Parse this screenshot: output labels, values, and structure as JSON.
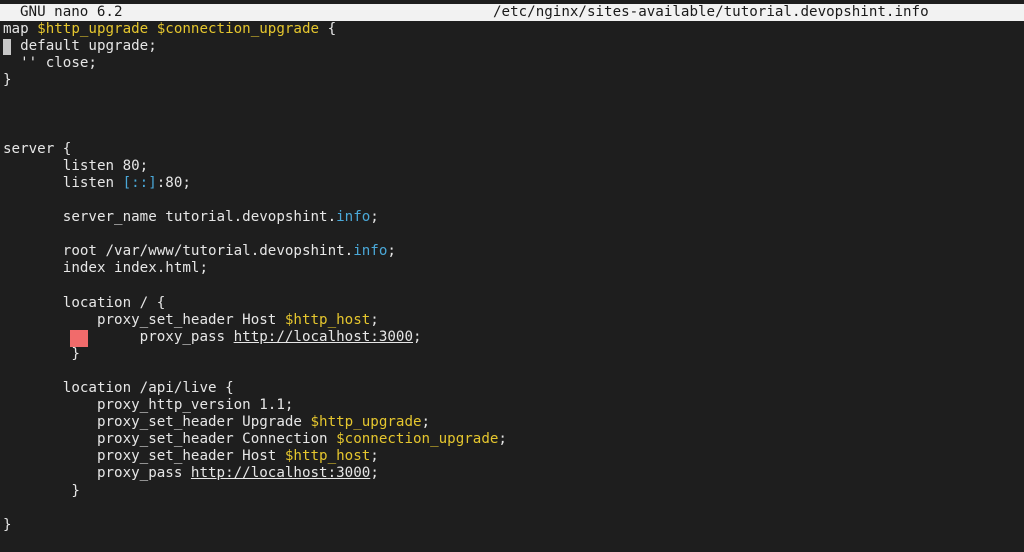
{
  "titlebar": {
    "app": "GNU nano 6.2",
    "file": "/etc/nginx/sites-available/tutorial.devopshint.info"
  },
  "colors": {
    "background": "#1e1e1e",
    "text": "#e6e6e6",
    "variable": "#e5c62e",
    "keyword": "#4aa8d8",
    "titlebar": "#f2f2f2",
    "marker": "#f16b6b"
  },
  "editor": {
    "lines": [
      [
        {
          "t": "map "
        },
        {
          "t": "$http_upgrade $connection_upgrade",
          "c": "yellow"
        },
        {
          "t": " {"
        }
      ],
      [
        {
          "t": "  default upgrade;"
        }
      ],
      [
        {
          "t": "  '' close;"
        }
      ],
      [
        {
          "t": "}"
        }
      ],
      [],
      [],
      [],
      [
        {
          "t": "server {"
        }
      ],
      [
        {
          "t": "       listen 80;"
        }
      ],
      [
        {
          "t": "       listen "
        },
        {
          "t": "[::]",
          "c": "cyan"
        },
        {
          "t": ":80;"
        }
      ],
      [],
      [
        {
          "t": "       server_name tutorial.devopshint."
        },
        {
          "t": "info",
          "c": "cyan"
        },
        {
          "t": ";"
        }
      ],
      [],
      [
        {
          "t": "       root /var/www/tutorial.devopshint."
        },
        {
          "t": "info",
          "c": "cyan"
        },
        {
          "t": ";"
        }
      ],
      [
        {
          "t": "       index index.html;"
        }
      ],
      [],
      [
        {
          "t": "       location / {"
        }
      ],
      [
        {
          "t": "           proxy_set_header Host "
        },
        {
          "t": "$http_host",
          "c": "yellow"
        },
        {
          "t": ";"
        }
      ],
      [
        {
          "t": "                proxy_pass "
        },
        {
          "t": "http://localhost:3000",
          "c": "ul"
        },
        {
          "t": ";"
        }
      ],
      [
        {
          "t": "        }"
        }
      ],
      [],
      [
        {
          "t": "       location /api/live {"
        }
      ],
      [
        {
          "t": "           proxy_http_version 1.1;"
        }
      ],
      [
        {
          "t": "           proxy_set_header Upgrade "
        },
        {
          "t": "$http_upgrade",
          "c": "yellow"
        },
        {
          "t": ";"
        }
      ],
      [
        {
          "t": "           proxy_set_header Connection "
        },
        {
          "t": "$connection_upgrade",
          "c": "yellow"
        },
        {
          "t": ";"
        }
      ],
      [
        {
          "t": "           proxy_set_header Host "
        },
        {
          "t": "$http_host",
          "c": "yellow"
        },
        {
          "t": ";"
        }
      ],
      [
        {
          "t": "           proxy_pass "
        },
        {
          "t": "http://localhost",
          "c": "ul"
        },
        {
          "t": ":3000",
          "c": "ul"
        },
        {
          "t": ";"
        }
      ],
      [
        {
          "t": "        }"
        }
      ],
      [],
      [
        {
          "t": "}"
        }
      ]
    ]
  }
}
